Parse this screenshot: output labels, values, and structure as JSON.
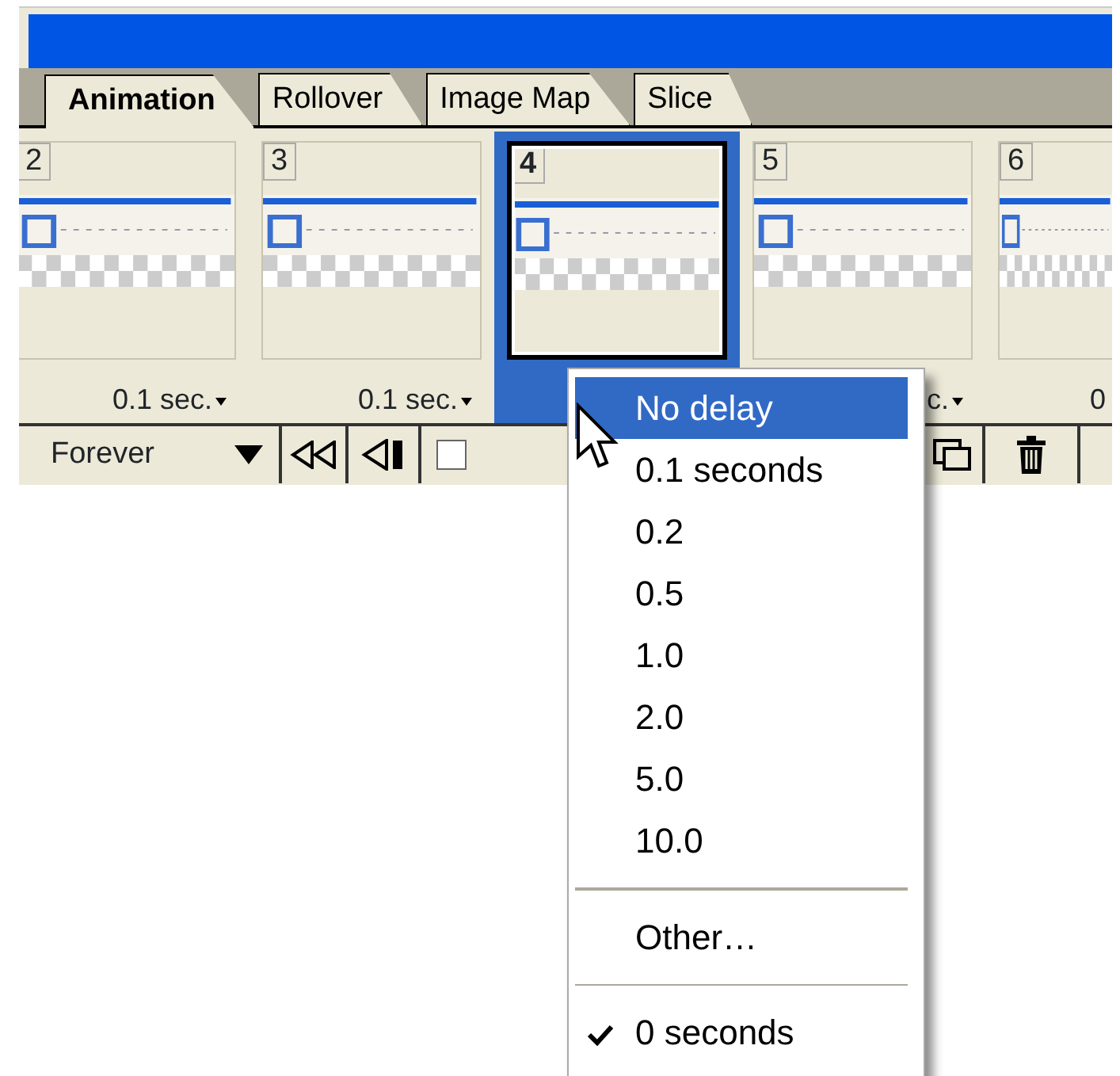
{
  "tabs": [
    {
      "label": "Animation",
      "selected": true
    },
    {
      "label": "Rollover",
      "selected": false
    },
    {
      "label": "Image Map",
      "selected": false
    },
    {
      "label": "Slice",
      "selected": false
    }
  ],
  "frames": [
    {
      "number": "2",
      "selected": false,
      "delay": "0.1 sec.",
      "delay_caret": true
    },
    {
      "number": "3",
      "selected": false,
      "delay": "0.1 sec.",
      "delay_caret": true
    },
    {
      "number": "4",
      "selected": true
    },
    {
      "number": "5",
      "selected": false,
      "delay": "c.",
      "delay_caret": true
    },
    {
      "number": "6",
      "selected": false,
      "delay": "0",
      "delay_caret": false
    }
  ],
  "toolbar": {
    "loop": "Forever",
    "buttons": [
      {
        "kind": "first"
      },
      {
        "kind": "previous"
      },
      {
        "kind": "square"
      },
      {
        "kind": "new"
      },
      {
        "kind": "delete"
      }
    ]
  },
  "delay_menu": {
    "items": [
      {
        "kind": "item",
        "label": "No delay",
        "selected": true,
        "checked": false
      },
      {
        "kind": "item",
        "label": "0.1 seconds",
        "selected": false,
        "checked": false
      },
      {
        "kind": "item",
        "label": "0.2",
        "selected": false,
        "checked": false
      },
      {
        "kind": "item",
        "label": "0.5",
        "selected": false,
        "checked": false
      },
      {
        "kind": "item",
        "label": "1.0",
        "selected": false,
        "checked": false
      },
      {
        "kind": "item",
        "label": "2.0",
        "selected": false,
        "checked": false
      },
      {
        "kind": "item",
        "label": "5.0",
        "selected": false,
        "checked": false
      },
      {
        "kind": "item",
        "label": "10.0",
        "selected": false,
        "checked": false
      },
      {
        "kind": "separator"
      },
      {
        "kind": "item",
        "label": "Other…",
        "selected": false,
        "checked": false
      },
      {
        "kind": "separator"
      },
      {
        "kind": "item",
        "label": "0 seconds",
        "selected": false,
        "checked": true
      }
    ]
  }
}
